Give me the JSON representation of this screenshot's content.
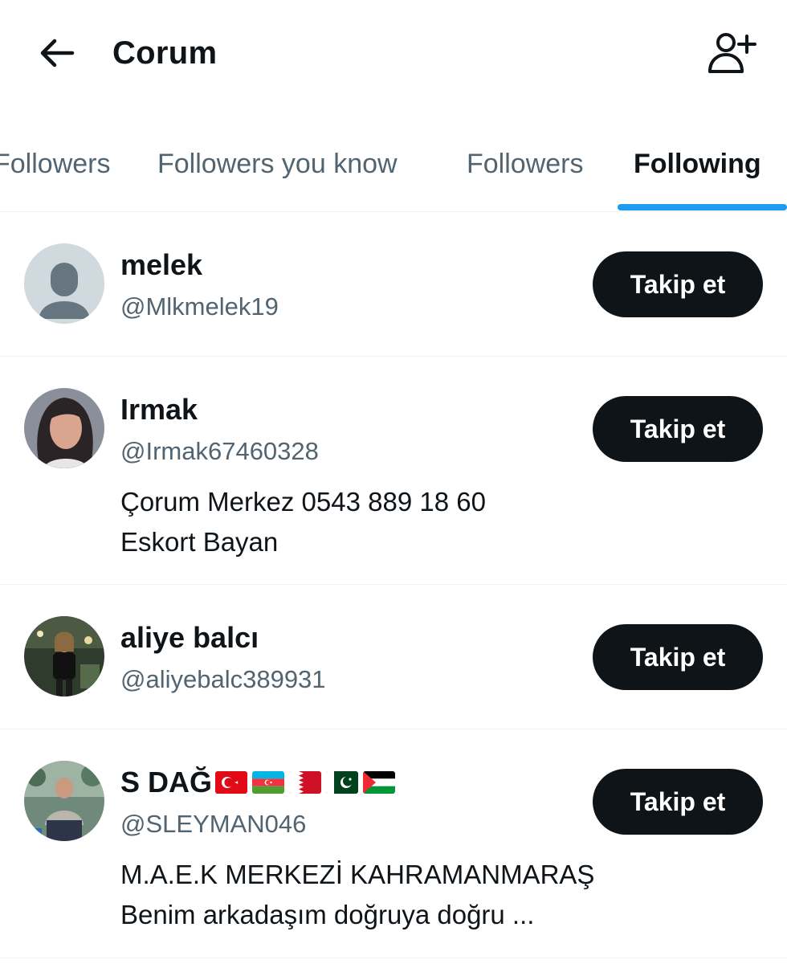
{
  "header": {
    "title": "Corum",
    "back_icon": "arrow-left-icon",
    "add_user_icon": "add-user-icon"
  },
  "tabs": [
    {
      "label": "Followers"
    },
    {
      "label": "Followers you know"
    },
    {
      "label": "Followers"
    },
    {
      "label": "Following",
      "active": true
    }
  ],
  "colors": {
    "accent": "#1d9bf0",
    "text_primary": "#0f1419",
    "text_secondary": "#536471",
    "button_bg": "#0f1419"
  },
  "users": [
    {
      "name": "melek",
      "handle": "@Mlkmelek19",
      "bio": [],
      "button": "Takip et"
    },
    {
      "name": "Irmak",
      "handle": "@Irmak67460328",
      "bio": [
        "Çorum Merkez 0543 889 18 60",
        "Eskort Bayan"
      ],
      "button": "Takip et"
    },
    {
      "name": "aliye balcı",
      "handle": "@aliyebalc389931",
      "bio": [],
      "button": "Takip et"
    },
    {
      "name": "S DAĞ",
      "handle": "@SLEYMAN046",
      "flags": [
        "turkey-flag",
        "azerbaijan-flag",
        "bahrain-flag",
        "pakistan-flag",
        "palestine-flag"
      ],
      "bio": [
        "M.A.E.K MERKEZİ KAHRAMANMARAŞ",
        "Benim arkadaşım doğruya doğru ..."
      ],
      "button": "Takip et"
    }
  ]
}
